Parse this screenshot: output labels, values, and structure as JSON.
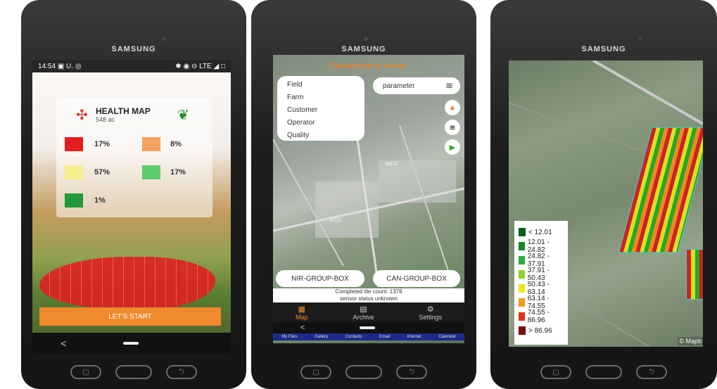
{
  "tablet1": {
    "brand": "SAMSUNG",
    "status": {
      "time": "14:54",
      "left_icons": "▣ U. ◎",
      "right_icons": "✱ ◉ ⊝ LTE ◢ □"
    },
    "title": "HEALTH MAP",
    "subtitle": "548 ac",
    "legend": [
      {
        "color": "#e31e1e",
        "pct": "17%"
      },
      {
        "color": "#f4a261",
        "pct": "8%"
      },
      {
        "color": "#f7ef8a",
        "pct": "57%"
      },
      {
        "color": "#5ecb6a",
        "pct": "17%"
      },
      {
        "color": "#1f9a3a",
        "pct": "1%"
      }
    ],
    "start_label": "LET'S START",
    "nav": {
      "back": "<",
      "recent": "▢",
      "back_hw": "⮌"
    }
  },
  "tablet2": {
    "brand": "SAMSUNG",
    "connection": "Connection to server",
    "menu": [
      "Field",
      "Farm",
      "Customer",
      "Operator",
      "Quality"
    ],
    "parameter_label": "parameter",
    "map_labels": [
      "SS12",
      "SS12",
      "SS12"
    ],
    "group_left": "NIR-GROUP-BOX",
    "group_right": "CAN-GROUP-BOX",
    "status_line1": "Completed tile count: 1376",
    "status_line2": "sensor status unknown",
    "tabs": [
      {
        "label": "Map",
        "icon": "▦"
      },
      {
        "label": "Archive",
        "icon": "▤"
      },
      {
        "label": "Settings",
        "icon": "⚙"
      }
    ],
    "dock": [
      "My Files",
      "Gallery",
      "Contacts",
      "Email",
      "Internet",
      "Calendar"
    ]
  },
  "tablet3": {
    "brand": "SAMSUNG",
    "legend": [
      {
        "label": "< 12.01",
        "color": "#0b5d1e"
      },
      {
        "label": "12.01 - 24.82",
        "color": "#128a2a"
      },
      {
        "label": "24.82 - 37.91",
        "color": "#26b13a"
      },
      {
        "label": "37.91 - 50.43",
        "color": "#8fd22a"
      },
      {
        "label": "50.43 - 63.14",
        "color": "#f1e516"
      },
      {
        "label": "63.14 - 74.55",
        "color": "#f39a1c"
      },
      {
        "label": "74.55 - 86.96",
        "color": "#e23218"
      },
      {
        "label": "> 86.96",
        "color": "#7a0c0c"
      }
    ],
    "attribution": "© Mapb"
  }
}
